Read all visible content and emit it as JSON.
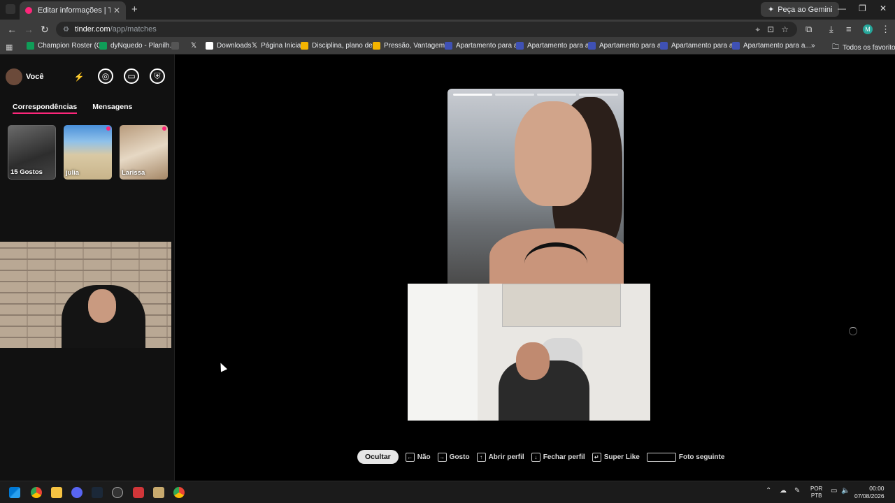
{
  "browser": {
    "tab_title": "Editar informações | Tinder",
    "tab_close": "✕",
    "new_tab": "+",
    "gemini_label": "Peça ao Gemini",
    "url_host": "tinder.com",
    "url_path": "/app/matches",
    "window_controls": [
      "—",
      "❐",
      "✕"
    ],
    "profile_initial": "M",
    "bookmarks": [
      {
        "label": "Champion Roster (C...",
        "color": "#0f9d58"
      },
      {
        "label": "dyNquedo - Planilh...",
        "color": "#0f9d58"
      },
      {
        "label": "",
        "color": "#555555"
      },
      {
        "label": "",
        "color": "#000000",
        "icon": "X"
      },
      {
        "label": "Downloads",
        "color": "#ffffff"
      },
      {
        "label": "Página Inicial",
        "color": "#000000",
        "icon": "X"
      },
      {
        "label": "Disciplina, plano de...",
        "color": "#f4b400"
      },
      {
        "label": "Pressão, Vantagem...",
        "color": "#f4b400"
      },
      {
        "label": "Apartamento para a...",
        "color": "#3f51b5"
      },
      {
        "label": "Apartamento para a...",
        "color": "#3f51b5"
      },
      {
        "label": "Apartamento para a...",
        "color": "#3f51b5"
      },
      {
        "label": "Apartamento para a...",
        "color": "#3f51b5"
      },
      {
        "label": "Apartamento para a...",
        "color": "#3f51b5"
      }
    ],
    "bookmarks_more": "»",
    "all_bookmarks": "Todos os favoritos"
  },
  "tinder": {
    "user_label": "Você",
    "tabs": [
      "Correspondências",
      "Mensagens"
    ],
    "matches": [
      {
        "label": "15 Gostos",
        "new": false
      },
      {
        "label": "julia",
        "new": true
      },
      {
        "label": "Larissa",
        "new": true
      }
    ],
    "photo_bars": 4,
    "hints": {
      "hide": "Ocultar",
      "nope": "Não",
      "like": "Gosto",
      "open_profile": "Abrir perfil",
      "close_profile": "Fechar perfil",
      "super_like": "Super Like",
      "next_photo": "Foto seguinte"
    }
  },
  "taskbar": {
    "lang_top": "POR",
    "lang_bottom": "PTB",
    "time": "00:00",
    "date": "07/08/2026"
  },
  "colors": {
    "tinder_accent": "#fd267a",
    "sidebar_bg": "#111111",
    "page_bg": "#000000"
  }
}
